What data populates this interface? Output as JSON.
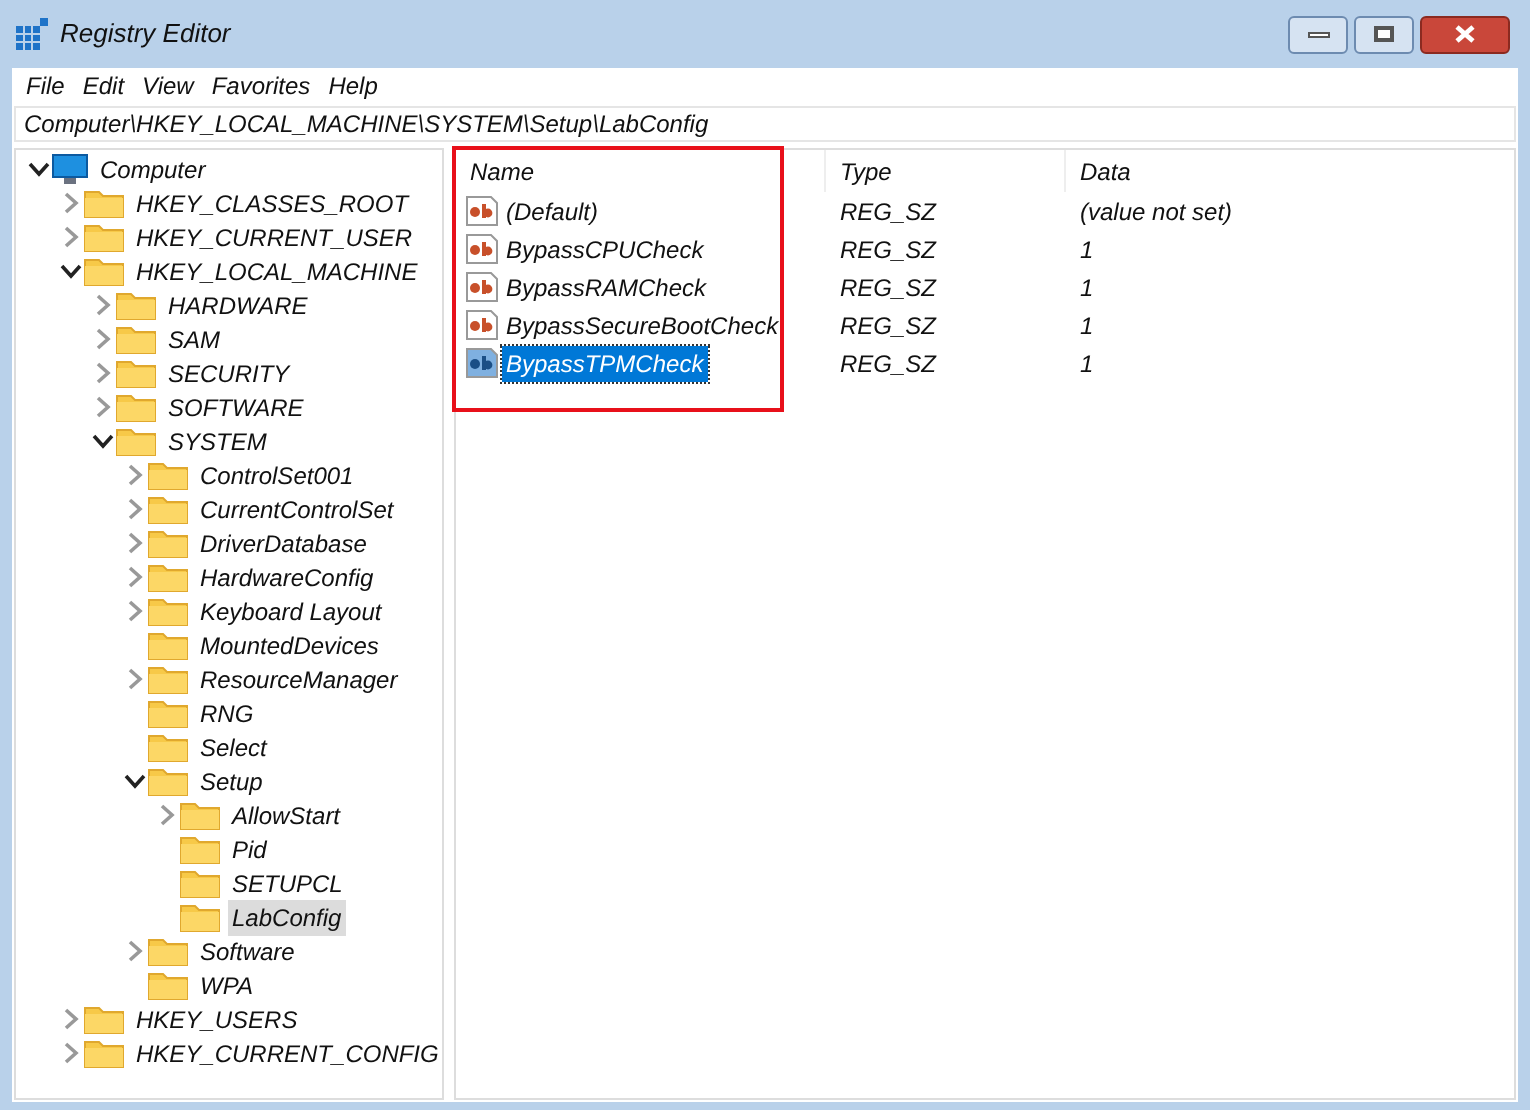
{
  "window": {
    "title": "Registry Editor"
  },
  "menu": [
    "File",
    "Edit",
    "View",
    "Favorites",
    "Help"
  ],
  "address": "Computer\\HKEY_LOCAL_MACHINE\\SYSTEM\\Setup\\LabConfig",
  "tree": [
    {
      "label": "Computer",
      "kind": "computer",
      "expanded": true,
      "selected": false,
      "children": [
        {
          "label": "HKEY_CLASSES_ROOT",
          "kind": "branch",
          "expanded": false,
          "selected": false
        },
        {
          "label": "HKEY_CURRENT_USER",
          "kind": "branch",
          "expanded": false,
          "selected": false
        },
        {
          "label": "HKEY_LOCAL_MACHINE",
          "kind": "branch",
          "expanded": true,
          "selected": false,
          "children": [
            {
              "label": "HARDWARE",
              "kind": "branch",
              "expanded": false,
              "selected": false
            },
            {
              "label": "SAM",
              "kind": "branch",
              "expanded": false,
              "selected": false
            },
            {
              "label": "SECURITY",
              "kind": "branch",
              "expanded": false,
              "selected": false
            },
            {
              "label": "SOFTWARE",
              "kind": "branch",
              "expanded": false,
              "selected": false
            },
            {
              "label": "SYSTEM",
              "kind": "branch",
              "expanded": true,
              "selected": false,
              "children": [
                {
                  "label": "ControlSet001",
                  "kind": "branch",
                  "expanded": false,
                  "selected": false
                },
                {
                  "label": "CurrentControlSet",
                  "kind": "branch",
                  "expanded": false,
                  "selected": false
                },
                {
                  "label": "DriverDatabase",
                  "kind": "branch",
                  "expanded": false,
                  "selected": false
                },
                {
                  "label": "HardwareConfig",
                  "kind": "branch",
                  "expanded": false,
                  "selected": false
                },
                {
                  "label": "Keyboard Layout",
                  "kind": "branch",
                  "expanded": false,
                  "selected": false
                },
                {
                  "label": "MountedDevices",
                  "kind": "leaf",
                  "selected": false
                },
                {
                  "label": "ResourceManager",
                  "kind": "branch",
                  "expanded": false,
                  "selected": false
                },
                {
                  "label": "RNG",
                  "kind": "leaf",
                  "selected": false
                },
                {
                  "label": "Select",
                  "kind": "leaf",
                  "selected": false
                },
                {
                  "label": "Setup",
                  "kind": "branch",
                  "expanded": true,
                  "selected": false,
                  "children": [
                    {
                      "label": "AllowStart",
                      "kind": "branch",
                      "expanded": false,
                      "selected": false
                    },
                    {
                      "label": "Pid",
                      "kind": "leaf",
                      "selected": false
                    },
                    {
                      "label": "SETUPCL",
                      "kind": "leaf",
                      "selected": false
                    },
                    {
                      "label": "LabConfig",
                      "kind": "leaf",
                      "selected": true
                    }
                  ]
                },
                {
                  "label": "Software",
                  "kind": "branch",
                  "expanded": false,
                  "selected": false
                },
                {
                  "label": "WPA",
                  "kind": "leaf",
                  "selected": false
                }
              ]
            }
          ]
        },
        {
          "label": "HKEY_USERS",
          "kind": "branch",
          "expanded": false,
          "selected": false
        },
        {
          "label": "HKEY_CURRENT_CONFIG",
          "kind": "branch",
          "expanded": false,
          "selected": false
        }
      ]
    }
  ],
  "table": {
    "columns": [
      "Name",
      "Type",
      "Data"
    ],
    "rows": [
      {
        "name": "(Default)",
        "type": "REG_SZ",
        "data": "(value not set)",
        "selected": false
      },
      {
        "name": "BypassCPUCheck",
        "type": "REG_SZ",
        "data": "1",
        "selected": false
      },
      {
        "name": "BypassRAMCheck",
        "type": "REG_SZ",
        "data": "1",
        "selected": false
      },
      {
        "name": "BypassSecureBootCheck",
        "type": "REG_SZ",
        "data": "1",
        "selected": false
      },
      {
        "name": "BypassTPMCheck",
        "type": "REG_SZ",
        "data": "1",
        "selected": true
      }
    ]
  }
}
